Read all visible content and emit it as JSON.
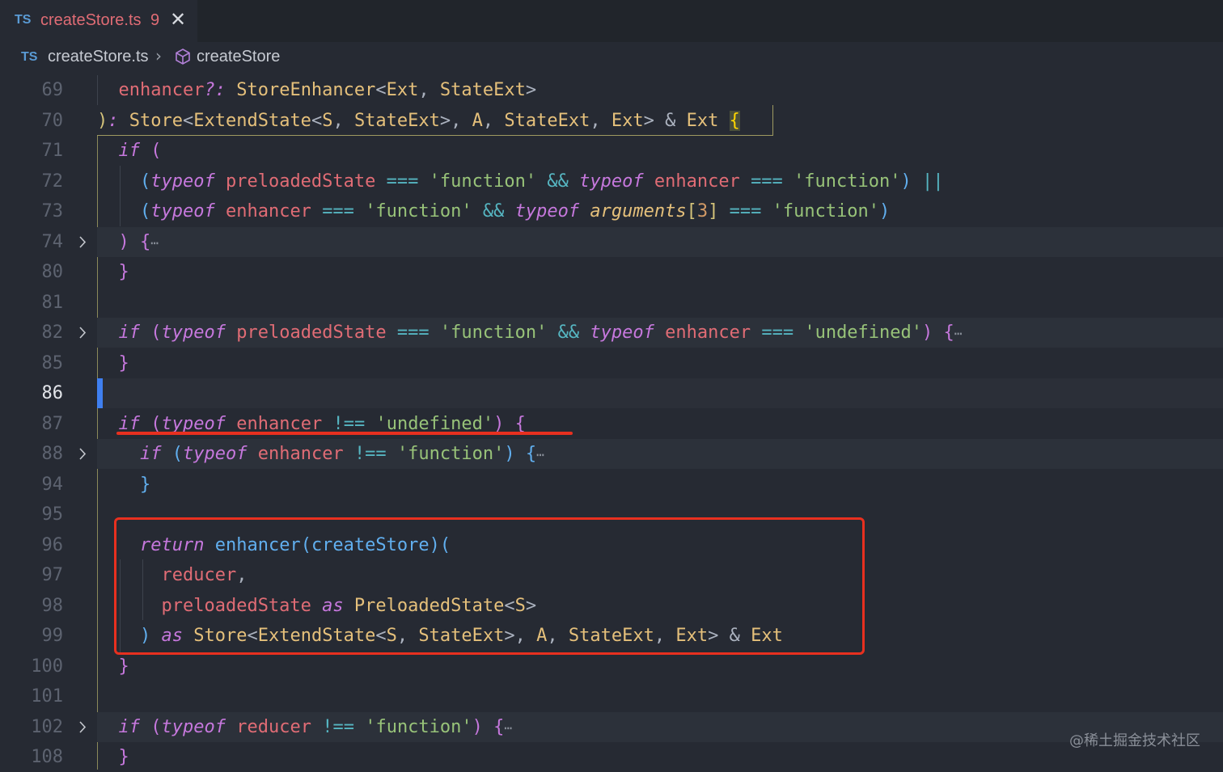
{
  "tab": {
    "lang": "TS",
    "filename": "createStore.ts",
    "problems": "9",
    "close": "✕"
  },
  "breadcrumb": {
    "lang": "TS",
    "file": "createStore.ts",
    "separator": "›",
    "symbol": "createStore"
  },
  "lines": [
    {
      "num": "69",
      "fold": false,
      "tokens": [
        [
          "",
          "  "
        ],
        [
          "v",
          "enhancer"
        ],
        [
          "k",
          "?:"
        ],
        [
          "p",
          " "
        ],
        [
          "t",
          "StoreEnhancer"
        ],
        [
          "p",
          "<"
        ],
        [
          "t",
          "Ext"
        ],
        [
          "p",
          ", "
        ],
        [
          "t",
          "StateExt"
        ],
        [
          "p",
          ">"
        ]
      ]
    },
    {
      "num": "70",
      "fold": false,
      "tokens": [
        [
          "y",
          ")"
        ],
        [
          "k",
          ":"
        ],
        [
          "p",
          " "
        ],
        [
          "t",
          "Store"
        ],
        [
          "p",
          "<"
        ],
        [
          "t",
          "ExtendState"
        ],
        [
          "p",
          "<"
        ],
        [
          "t",
          "S"
        ],
        [
          "p",
          ", "
        ],
        [
          "t",
          "StateExt"
        ],
        [
          "p",
          ">, "
        ],
        [
          "t",
          "A"
        ],
        [
          "p",
          ", "
        ],
        [
          "t",
          "StateExt"
        ],
        [
          "p",
          ", "
        ],
        [
          "t",
          "Ext"
        ],
        [
          "p",
          "> & "
        ],
        [
          "t",
          "Ext"
        ],
        [
          "p",
          " "
        ],
        [
          "b3",
          "{"
        ]
      ]
    },
    {
      "num": "71",
      "fold": false,
      "tokens": [
        [
          "",
          "  "
        ],
        [
          "k",
          "if"
        ],
        [
          "p",
          " "
        ],
        [
          "b1",
          "("
        ]
      ]
    },
    {
      "num": "72",
      "fold": false,
      "tokens": [
        [
          "",
          "    "
        ],
        [
          "b2",
          "("
        ],
        [
          "k",
          "typeof"
        ],
        [
          "p",
          " "
        ],
        [
          "v",
          "preloadedState"
        ],
        [
          "p",
          " "
        ],
        [
          "o",
          "==="
        ],
        [
          "p",
          " "
        ],
        [
          "s",
          "'function'"
        ],
        [
          "p",
          " "
        ],
        [
          "o",
          "&&"
        ],
        [
          "p",
          " "
        ],
        [
          "k",
          "typeof"
        ],
        [
          "p",
          " "
        ],
        [
          "v",
          "enhancer"
        ],
        [
          "p",
          " "
        ],
        [
          "o",
          "==="
        ],
        [
          "p",
          " "
        ],
        [
          "s",
          "'function'"
        ],
        [
          "b2",
          ")"
        ],
        [
          "p",
          " "
        ],
        [
          "o",
          "||"
        ]
      ]
    },
    {
      "num": "73",
      "fold": false,
      "tokens": [
        [
          "",
          "    "
        ],
        [
          "b2",
          "("
        ],
        [
          "k",
          "typeof"
        ],
        [
          "p",
          " "
        ],
        [
          "v",
          "enhancer"
        ],
        [
          "p",
          " "
        ],
        [
          "o",
          "==="
        ],
        [
          "p",
          " "
        ],
        [
          "s",
          "'function'"
        ],
        [
          "p",
          " "
        ],
        [
          "o",
          "&&"
        ],
        [
          "p",
          " "
        ],
        [
          "k",
          "typeof"
        ],
        [
          "p",
          " "
        ],
        [
          "ya",
          "arguments"
        ],
        [
          "y",
          "["
        ],
        [
          "n",
          "3"
        ],
        [
          "y",
          "]"
        ],
        [
          "p",
          " "
        ],
        [
          "o",
          "==="
        ],
        [
          "p",
          " "
        ],
        [
          "s",
          "'function'"
        ],
        [
          "b2",
          ")"
        ]
      ]
    },
    {
      "num": "74",
      "fold": true,
      "tokens": [
        [
          "",
          "  "
        ],
        [
          "b1",
          ")"
        ],
        [
          "p",
          " "
        ],
        [
          "b1",
          "{"
        ],
        [
          "ell",
          "⋯"
        ]
      ]
    },
    {
      "num": "80",
      "fold": false,
      "tokens": [
        [
          "",
          "  "
        ],
        [
          "b1",
          "}"
        ]
      ]
    },
    {
      "num": "81",
      "fold": false,
      "tokens": []
    },
    {
      "num": "82",
      "fold": true,
      "tokens": [
        [
          "",
          "  "
        ],
        [
          "k",
          "if"
        ],
        [
          "p",
          " "
        ],
        [
          "b1",
          "("
        ],
        [
          "k",
          "typeof"
        ],
        [
          "p",
          " "
        ],
        [
          "v",
          "preloadedState"
        ],
        [
          "p",
          " "
        ],
        [
          "o",
          "==="
        ],
        [
          "p",
          " "
        ],
        [
          "s",
          "'function'"
        ],
        [
          "p",
          " "
        ],
        [
          "o",
          "&&"
        ],
        [
          "p",
          " "
        ],
        [
          "k",
          "typeof"
        ],
        [
          "p",
          " "
        ],
        [
          "v",
          "enhancer"
        ],
        [
          "p",
          " "
        ],
        [
          "o",
          "==="
        ],
        [
          "p",
          " "
        ],
        [
          "s",
          "'undefined'"
        ],
        [
          "b1",
          ")"
        ],
        [
          "p",
          " "
        ],
        [
          "b1",
          "{"
        ],
        [
          "ell",
          "⋯"
        ]
      ]
    },
    {
      "num": "85",
      "fold": false,
      "tokens": [
        [
          "",
          "  "
        ],
        [
          "b1",
          "}"
        ]
      ]
    },
    {
      "num": "86",
      "fold": false,
      "current": true,
      "tokens": []
    },
    {
      "num": "87",
      "fold": false,
      "tokens": [
        [
          "",
          "  "
        ],
        [
          "k",
          "if"
        ],
        [
          "p",
          " "
        ],
        [
          "b1",
          "("
        ],
        [
          "k",
          "typeof"
        ],
        [
          "p",
          " "
        ],
        [
          "v",
          "enhancer"
        ],
        [
          "p",
          " "
        ],
        [
          "o",
          "!=="
        ],
        [
          "p",
          " "
        ],
        [
          "s",
          "'undefined'"
        ],
        [
          "b1",
          ")"
        ],
        [
          "p",
          " "
        ],
        [
          "b1",
          "{"
        ]
      ]
    },
    {
      "num": "88",
      "fold": true,
      "tokens": [
        [
          "",
          "    "
        ],
        [
          "k",
          "if"
        ],
        [
          "p",
          " "
        ],
        [
          "b2",
          "("
        ],
        [
          "k",
          "typeof"
        ],
        [
          "p",
          " "
        ],
        [
          "v",
          "enhancer"
        ],
        [
          "p",
          " "
        ],
        [
          "o",
          "!=="
        ],
        [
          "p",
          " "
        ],
        [
          "s",
          "'function'"
        ],
        [
          "b2",
          ")"
        ],
        [
          "p",
          " "
        ],
        [
          "b2",
          "{"
        ],
        [
          "ell",
          "⋯"
        ]
      ]
    },
    {
      "num": "94",
      "fold": false,
      "tokens": [
        [
          "",
          "    "
        ],
        [
          "b2",
          "}"
        ]
      ]
    },
    {
      "num": "95",
      "fold": false,
      "tokens": []
    },
    {
      "num": "96",
      "fold": false,
      "tokens": [
        [
          "",
          "    "
        ],
        [
          "k",
          "return"
        ],
        [
          "p",
          " "
        ],
        [
          "f",
          "enhancer"
        ],
        [
          "b2",
          "("
        ],
        [
          "f",
          "createStore"
        ],
        [
          "b2",
          ")("
        ]
      ]
    },
    {
      "num": "97",
      "fold": false,
      "tokens": [
        [
          "",
          "      "
        ],
        [
          "v",
          "reducer"
        ],
        [
          "p",
          ","
        ]
      ]
    },
    {
      "num": "98",
      "fold": false,
      "tokens": [
        [
          "",
          "      "
        ],
        [
          "v",
          "preloadedState"
        ],
        [
          "p",
          " "
        ],
        [
          "k",
          "as"
        ],
        [
          "p",
          " "
        ],
        [
          "t",
          "PreloadedState"
        ],
        [
          "p",
          "<"
        ],
        [
          "t",
          "S"
        ],
        [
          "p",
          ">"
        ]
      ]
    },
    {
      "num": "99",
      "fold": false,
      "tokens": [
        [
          "",
          "    "
        ],
        [
          "b2",
          ")"
        ],
        [
          "p",
          " "
        ],
        [
          "k",
          "as"
        ],
        [
          "p",
          " "
        ],
        [
          "t",
          "Store"
        ],
        [
          "p",
          "<"
        ],
        [
          "t",
          "ExtendState"
        ],
        [
          "p",
          "<"
        ],
        [
          "t",
          "S"
        ],
        [
          "p",
          ", "
        ],
        [
          "t",
          "StateExt"
        ],
        [
          "p",
          ">, "
        ],
        [
          "t",
          "A"
        ],
        [
          "p",
          ", "
        ],
        [
          "t",
          "StateExt"
        ],
        [
          "p",
          ", "
        ],
        [
          "t",
          "Ext"
        ],
        [
          "p",
          "> & "
        ],
        [
          "t",
          "Ext"
        ]
      ]
    },
    {
      "num": "100",
      "fold": false,
      "tokens": [
        [
          "",
          "  "
        ],
        [
          "b1",
          "}"
        ]
      ]
    },
    {
      "num": "101",
      "fold": false,
      "tokens": []
    },
    {
      "num": "102",
      "fold": true,
      "tokens": [
        [
          "",
          "  "
        ],
        [
          "k",
          "if"
        ],
        [
          "p",
          " "
        ],
        [
          "b1",
          "("
        ],
        [
          "k",
          "typeof"
        ],
        [
          "p",
          " "
        ],
        [
          "v",
          "reducer"
        ],
        [
          "p",
          " "
        ],
        [
          "o",
          "!=="
        ],
        [
          "p",
          " "
        ],
        [
          "s",
          "'function'"
        ],
        [
          "b1",
          ")"
        ],
        [
          "p",
          " "
        ],
        [
          "b1",
          "{"
        ],
        [
          "ell",
          "⋯"
        ]
      ]
    },
    {
      "num": "108",
      "fold": false,
      "tokens": [
        [
          "",
          "  "
        ],
        [
          "b1",
          "}"
        ]
      ]
    }
  ],
  "watermark": "@稀土掘金技术社区",
  "colors": {
    "background": "#262a33",
    "underline": "#e8301f",
    "box": "#e8301f",
    "current_line_marker": "#3f7ff0"
  }
}
